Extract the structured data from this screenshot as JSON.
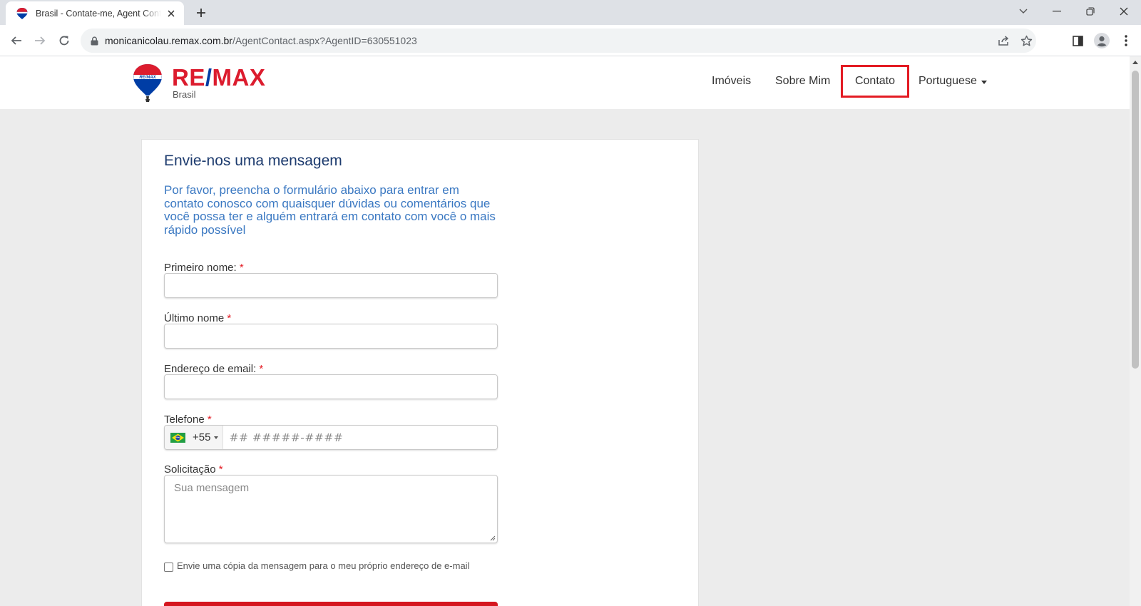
{
  "browser": {
    "tab_title": "Brasil - Contate-me, Agent Contact",
    "url_host": "monicanicolau.remax.com.br",
    "url_path": "/AgentContact.aspx?AgentID=630551023"
  },
  "brand": {
    "logo_word_left": "RE",
    "logo_word_slash": "/",
    "logo_word_right": "MAX",
    "logo_sub": "Brasil",
    "balloon_text": "RE/MAX",
    "color_red": "#dc1c2e",
    "color_blue": "#003da5"
  },
  "nav": {
    "items": [
      {
        "label": "Imóveis"
      },
      {
        "label": "Sobre Mim"
      },
      {
        "label": "Contato",
        "active": true
      },
      {
        "label": "Portuguese"
      }
    ]
  },
  "form": {
    "title": "Envie-nos uma mensagem",
    "intro": "Por favor, preencha o formulário abaixo para entrar em contato conosco com quaisquer dúvidas ou comentários que você possa ter e alguém entrará em contato com você o mais rápido possível",
    "required_mark": "*",
    "first_name_label": "Primeiro nome:",
    "first_name_value": "",
    "last_name_label": "Último nome",
    "last_name_value": "",
    "email_label": "Endereço de email:",
    "email_value": "",
    "phone_label": "Telefone",
    "phone_country": "+55",
    "phone_placeholder": "## #####-####",
    "message_label": "Solicitação",
    "message_placeholder": "Sua mensagem",
    "copy_checkbox_label": "Envie uma cópia da mensagem para o meu próprio endereço de e-mail",
    "copy_checked": false
  }
}
